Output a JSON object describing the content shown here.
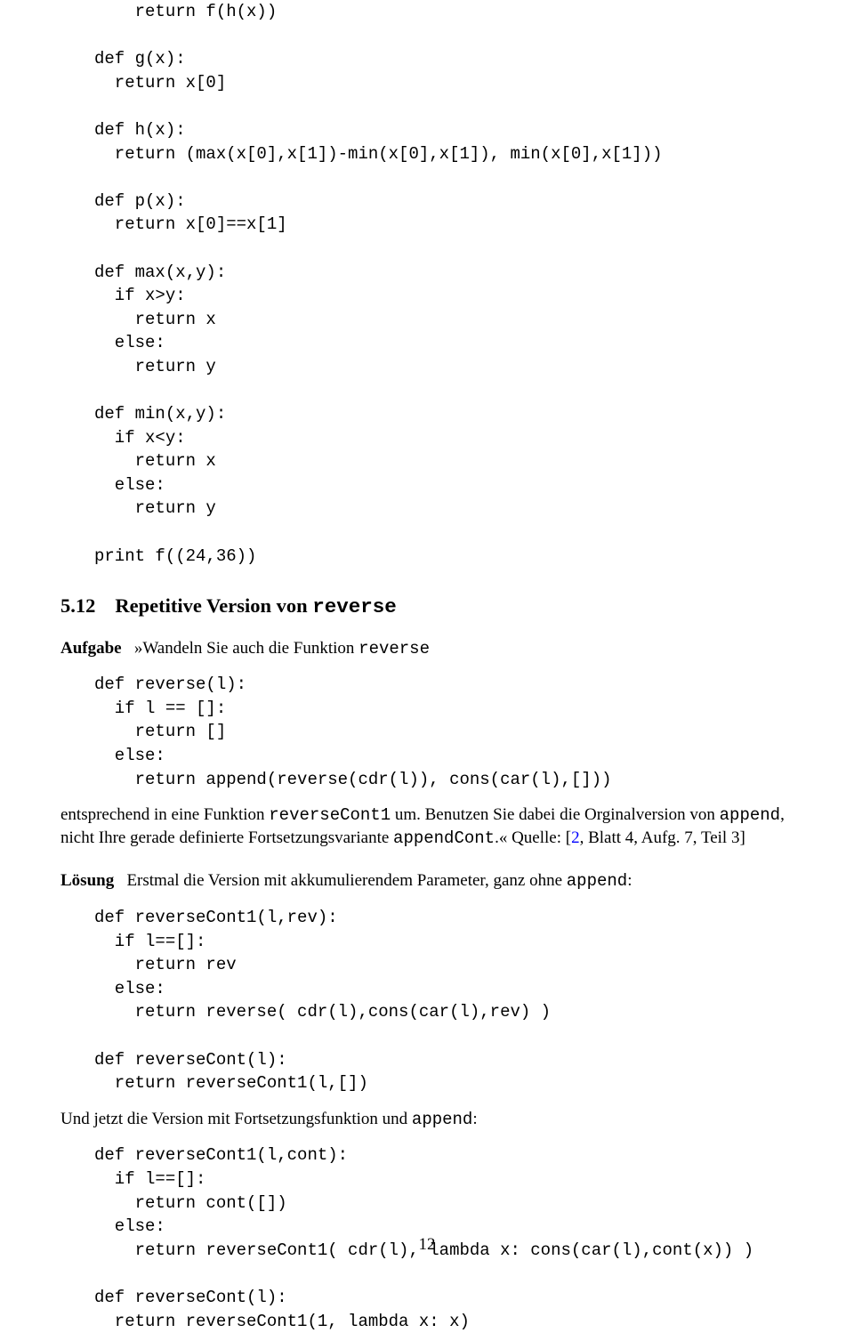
{
  "code1": "    return f(h(x))\n\ndef g(x):\n  return x[0]\n\ndef h(x):\n  return (max(x[0],x[1])-min(x[0],x[1]), min(x[0],x[1]))\n\ndef p(x):\n  return x[0]==x[1]\n\ndef max(x,y):\n  if x>y:\n    return x\n  else:\n    return y\n\ndef min(x,y):\n  if x<y:\n    return x\n  else:\n    return y\n\nprint f((24,36))",
  "section": {
    "number": "5.12",
    "title_prefix": "Repetitive Version von ",
    "title_mono": "reverse"
  },
  "aufgabe": {
    "label": "Aufgabe",
    "text1": "   »Wandeln Sie auch die Funktion ",
    "mono1": "reverse"
  },
  "code2": "def reverse(l):\n  if l == []:\n    return []\n  else:\n    return append(reverse(cdr(l)), cons(car(l),[]))",
  "para1": {
    "t1": "entsprechend in eine Funktion ",
    "m1": "reverseCont1",
    "t2": " um. Benutzen Sie dabei die Orginalversion von ",
    "m2": "append",
    "t3": ", nicht Ihre gerade definierte Fortsetzungsvariante ",
    "m3": "appendCont",
    "t4": ".« Quelle: [",
    "cite": "2",
    "t5": ", Blatt 4, Aufg. 7, Teil 3]"
  },
  "loesung": {
    "label": "Lösung",
    "text1": "   Erstmal die Version mit akkumulierendem Parameter, ganz ohne ",
    "mono1": "append",
    "text2": ":"
  },
  "code3": "def reverseCont1(l,rev):\n  if l==[]:\n    return rev\n  else:\n    return reverse( cdr(l),cons(car(l),rev) )\n\ndef reverseCont(l):\n  return reverseCont1(l,[])",
  "para2": {
    "t1": "Und jetzt die Version mit Fortsetzungsfunktion und ",
    "m1": "append",
    "t2": ":"
  },
  "code4": "def reverseCont1(l,cont):\n  if l==[]:\n    return cont([])\n  else:\n    return reverseCont1( cdr(l), lambda x: cons(car(l),cont(x)) )\n\ndef reverseCont(l):\n  return reverseCont1(1, lambda x: x)",
  "pageNumber": "12"
}
